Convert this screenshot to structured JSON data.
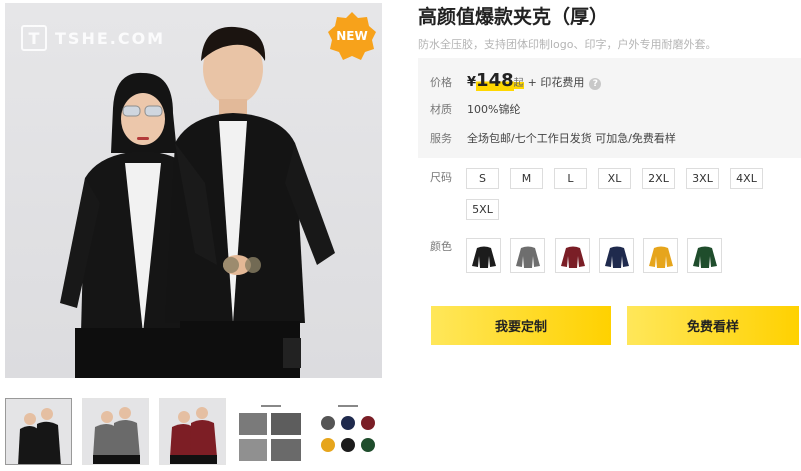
{
  "product": {
    "title": "高颜值爆款夹克（厚）",
    "subtitle": "防水全压胶，支持团体印制logo、印字，户外专用耐磨外套。"
  },
  "gallery": {
    "watermark_logo": "T",
    "watermark_text": "TSHE.COM",
    "badge": "NEW",
    "thumbnails": [
      {
        "name": "black-pair",
        "active": true
      },
      {
        "name": "grey-pair",
        "active": false
      },
      {
        "name": "red-pair",
        "active": false
      },
      {
        "name": "detail-shots",
        "active": false
      },
      {
        "name": "color-lineup",
        "active": false
      }
    ]
  },
  "info": {
    "price_label": "价格",
    "price_symbol": "¥",
    "price_value": "148",
    "price_unit": "起",
    "price_extra": "+ 印花费用",
    "help_icon": "?",
    "material_label": "材质",
    "material_value": "100%锦纶",
    "service_label": "服务",
    "service_value": "全场包邮/七个工作日发货 可加急/免费看样"
  },
  "options": {
    "size_label": "尺码",
    "sizes": [
      "S",
      "M",
      "L",
      "XL",
      "2XL",
      "3XL",
      "4XL",
      "5XL"
    ],
    "color_label": "颜色",
    "colors": [
      {
        "name": "black",
        "hex": "#1c1c1c"
      },
      {
        "name": "grey",
        "hex": "#6e6e6e"
      },
      {
        "name": "burgundy",
        "hex": "#7a1e26"
      },
      {
        "name": "navy",
        "hex": "#1f2a4d"
      },
      {
        "name": "yellow",
        "hex": "#e6a51c"
      },
      {
        "name": "green",
        "hex": "#1f4d2c"
      }
    ]
  },
  "actions": {
    "customize": "我要定制",
    "free_sample": "免费看样"
  },
  "theme": {
    "accent": "#ffd700",
    "badge_color": "#f7a21b"
  }
}
